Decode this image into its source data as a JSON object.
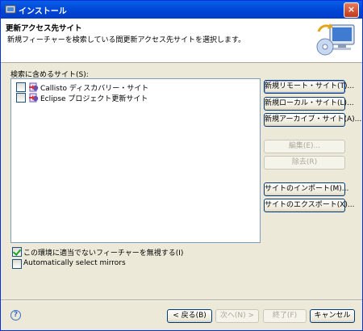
{
  "window": {
    "title": "インストール",
    "close_label": "×"
  },
  "banner": {
    "title": "更新アクセス先サイト",
    "description": "新規フィーチャーを検索している間更新アクセス先サイトを選択します。",
    "image_icon": "install-wizard-icon"
  },
  "sites": {
    "label": "検索に含めるサイト(S):",
    "items": [
      {
        "label": "Callisto ディスカバリー・サイト",
        "checked": false,
        "icon": "update-site-icon"
      },
      {
        "label": "Eclipse プロジェクト更新サイト",
        "checked": false,
        "icon": "update-site-icon"
      }
    ]
  },
  "side_buttons": {
    "new_remote": "新規リモート・サイト(T)...",
    "new_local": "新規ローカル・サイト(L)...",
    "new_archive": "新規アーカイブ・サイト(A)...",
    "edit": "編集(E)...",
    "remove": "除去(R)",
    "import": "サイトのインポート(M)...",
    "export": "サイトのエクスポート(X)..."
  },
  "options": {
    "ignore_features": {
      "label": "この環境に適当でないフィーチャーを無視する(I)",
      "checked": true
    },
    "auto_mirrors": {
      "label": "Automatically select mirrors",
      "checked": false
    }
  },
  "footer": {
    "help": "?",
    "back": "< 戻る(B)",
    "next": "次へ(N) >",
    "finish": "終了(F)",
    "cancel": "キャンセル"
  },
  "colors": {
    "title_bar": "#0054e3",
    "dialog_bg": "#ece9d8",
    "check_mark": "#21a121"
  }
}
